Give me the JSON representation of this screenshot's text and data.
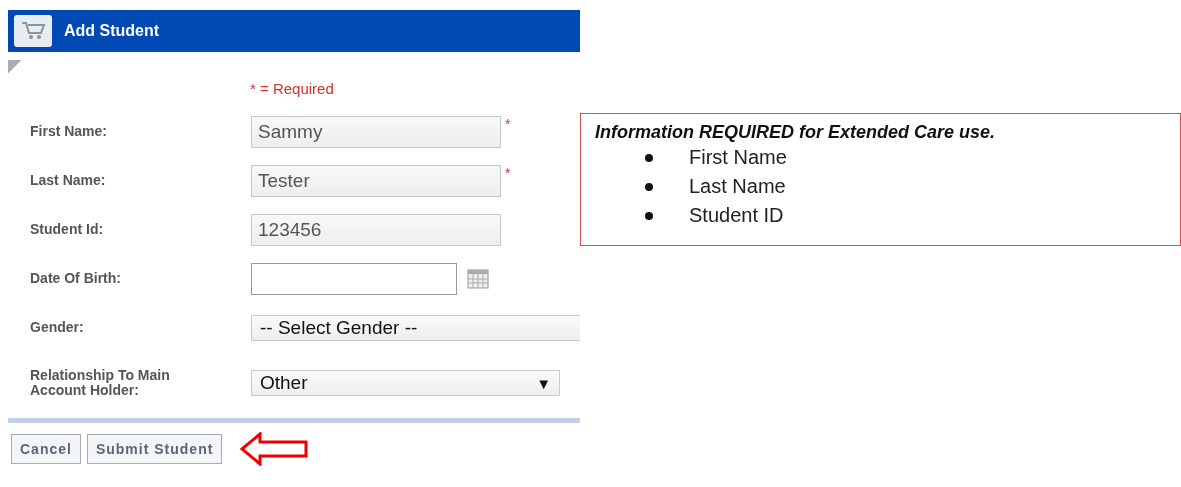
{
  "panel": {
    "title": "Add Student",
    "required_note": "* = Required"
  },
  "fields": [
    {
      "kind": "text",
      "label": "First Name:",
      "value": "Sammy",
      "required_mark": "*"
    },
    {
      "kind": "text",
      "label": "Last Name:",
      "value": "Tester",
      "required_mark": "*"
    },
    {
      "kind": "text",
      "label": "Student Id:",
      "value": "123456"
    },
    {
      "kind": "date",
      "label": "Date Of Birth:"
    },
    {
      "kind": "select",
      "label": "Gender:",
      "value": "-- Select Gender --"
    },
    {
      "kind": "select",
      "label": "Relationship To Main Account Holder:",
      "value": "Other",
      "arrow": "▼"
    }
  ],
  "buttons": [
    "Cancel",
    "Submit Student"
  ],
  "note": {
    "title": "Information REQUIRED for Extended Care use.",
    "items": [
      "First Name",
      "Last Name",
      "Student ID"
    ]
  }
}
